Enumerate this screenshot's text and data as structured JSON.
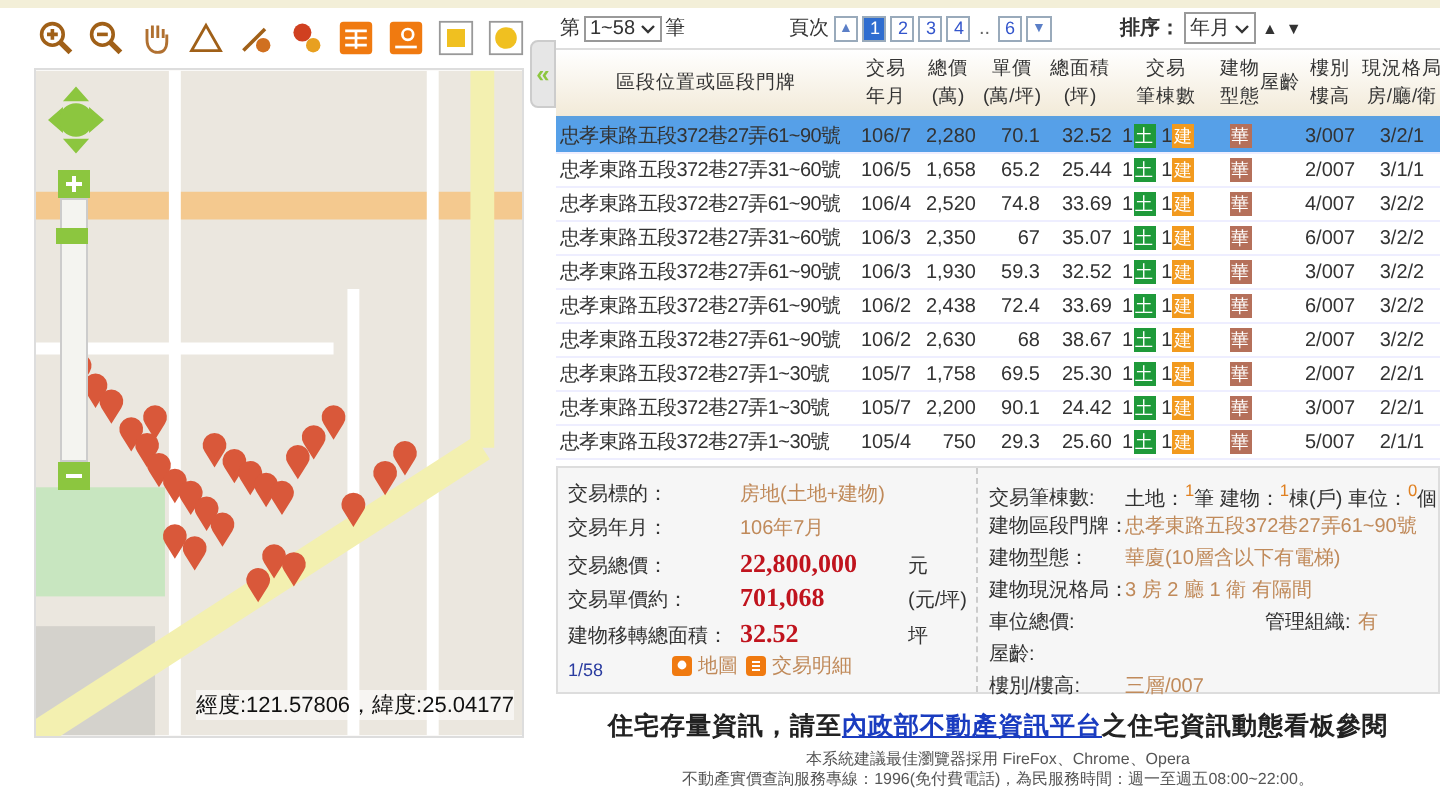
{
  "map": {
    "zoom_slider": {
      "level": 0.88
    },
    "coordinates": "經度:121.57806，緯度:25.04177"
  },
  "collapse_toggle": "«",
  "paging": {
    "prefix": "第",
    "range": "1~58",
    "suffix": "筆",
    "page_label": "頁次",
    "prev": "▲",
    "next": "▼",
    "pages": [
      {
        "label": "1",
        "kind": "page",
        "selected": true
      },
      {
        "label": "2",
        "kind": "page",
        "selected": false
      },
      {
        "label": "3",
        "kind": "page",
        "selected": false
      },
      {
        "label": "4",
        "kind": "page",
        "selected": false
      },
      {
        "label": "..",
        "kind": "gap"
      },
      {
        "label": "6",
        "kind": "page",
        "selected": false
      }
    ],
    "sort_label": "排序：",
    "sort_value": "年月",
    "sort_asc": "▲",
    "sort_desc": "▼"
  },
  "table": {
    "columns": [
      {
        "lines": [
          "區段位置或區段門牌"
        ]
      },
      {
        "lines": [
          "交易",
          "年月"
        ]
      },
      {
        "lines": [
          "總價",
          "(萬)"
        ]
      },
      {
        "lines": [
          "單價",
          "(萬/坪)"
        ]
      },
      {
        "lines": [
          "總面積",
          "(坪)"
        ]
      },
      {
        "lines": [
          "交易",
          "筆棟數"
        ]
      },
      {
        "lines": [
          "建物",
          "型態"
        ]
      },
      {
        "lines": [
          "屋齡"
        ]
      },
      {
        "lines": [
          "樓別",
          "樓高"
        ]
      },
      {
        "lines": [
          "現況格局",
          "房/廳/衛"
        ]
      }
    ],
    "rows": [
      {
        "selected": true,
        "address": "忠孝東路五段372巷27弄61~90號",
        "date": "106/7",
        "total": "2,280",
        "unit": "70.1",
        "area": "32.52",
        "land": "1",
        "land_badge": "土",
        "building": "1",
        "building_badge": "建",
        "type_badge": "華",
        "floor": "3/007",
        "layout": "3/2/1"
      },
      {
        "selected": false,
        "address": "忠孝東路五段372巷27弄31~60號",
        "date": "106/5",
        "total": "1,658",
        "unit": "65.2",
        "area": "25.44",
        "land": "1",
        "land_badge": "土",
        "building": "1",
        "building_badge": "建",
        "type_badge": "華",
        "floor": "2/007",
        "layout": "3/1/1"
      },
      {
        "selected": false,
        "address": "忠孝東路五段372巷27弄61~90號",
        "date": "106/4",
        "total": "2,520",
        "unit": "74.8",
        "area": "33.69",
        "land": "1",
        "land_badge": "土",
        "building": "1",
        "building_badge": "建",
        "type_badge": "華",
        "floor": "4/007",
        "layout": "3/2/2"
      },
      {
        "selected": false,
        "address": "忠孝東路五段372巷27弄31~60號",
        "date": "106/3",
        "total": "2,350",
        "unit": "67",
        "area": "35.07",
        "land": "1",
        "land_badge": "土",
        "building": "1",
        "building_badge": "建",
        "type_badge": "華",
        "floor": "6/007",
        "layout": "3/2/2"
      },
      {
        "selected": false,
        "address": "忠孝東路五段372巷27弄61~90號",
        "date": "106/3",
        "total": "1,930",
        "unit": "59.3",
        "area": "32.52",
        "land": "1",
        "land_badge": "土",
        "building": "1",
        "building_badge": "建",
        "type_badge": "華",
        "floor": "3/007",
        "layout": "3/2/2"
      },
      {
        "selected": false,
        "address": "忠孝東路五段372巷27弄61~90號",
        "date": "106/2",
        "total": "2,438",
        "unit": "72.4",
        "area": "33.69",
        "land": "1",
        "land_badge": "土",
        "building": "1",
        "building_badge": "建",
        "type_badge": "華",
        "floor": "6/007",
        "layout": "3/2/2"
      },
      {
        "selected": false,
        "address": "忠孝東路五段372巷27弄61~90號",
        "date": "106/2",
        "total": "2,630",
        "unit": "68",
        "area": "38.67",
        "land": "1",
        "land_badge": "土",
        "building": "1",
        "building_badge": "建",
        "type_badge": "華",
        "floor": "2/007",
        "layout": "3/2/2"
      },
      {
        "selected": false,
        "address": "忠孝東路五段372巷27弄1~30號",
        "date": "105/7",
        "total": "1,758",
        "unit": "69.5",
        "area": "25.30",
        "land": "1",
        "land_badge": "土",
        "building": "1",
        "building_badge": "建",
        "type_badge": "華",
        "floor": "2/007",
        "layout": "2/2/1"
      },
      {
        "selected": false,
        "address": "忠孝東路五段372巷27弄1~30號",
        "date": "105/7",
        "total": "2,200",
        "unit": "90.1",
        "area": "24.42",
        "land": "1",
        "land_badge": "土",
        "building": "1",
        "building_badge": "建",
        "type_badge": "華",
        "floor": "3/007",
        "layout": "2/2/1"
      },
      {
        "selected": false,
        "address": "忠孝東路五段372巷27弄1~30號",
        "date": "105/4",
        "total": "750",
        "unit": "29.3",
        "area": "25.60",
        "land": "1",
        "land_badge": "土",
        "building": "1",
        "building_badge": "建",
        "type_badge": "華",
        "floor": "5/007",
        "layout": "2/1/1"
      }
    ]
  },
  "detail": {
    "left": [
      {
        "kind": "plain",
        "label": "交易標的：",
        "value": "房地(土地+建物)"
      },
      {
        "kind": "plain",
        "label": "交易年月：",
        "value": "106年7月"
      },
      {
        "kind": "price",
        "label": "交易總價：",
        "value": "22,800,000",
        "unit": "元"
      },
      {
        "kind": "price",
        "label": "交易單價約：",
        "value": "701,068",
        "unit": "(元/坪)"
      },
      {
        "kind": "price",
        "label": "建物移轉總面積：",
        "value": "32.52",
        "unit": "坪"
      }
    ],
    "record": "1/58",
    "map_button": "地圖",
    "detail_button": "交易明細",
    "right": [
      {
        "kind": "counts",
        "label": "交易筆棟數:",
        "value": "土地：$^{1}$筆 建物：$^{1}$棟(戶) 車位：$^{0}$個"
      },
      {
        "kind": "plain",
        "label": "建物區段門牌：",
        "value": "忠孝東路五段372巷27弄61~90號"
      },
      {
        "kind": "plain",
        "label": "建物型態：",
        "value": "華廈(10層含以下有電梯)"
      },
      {
        "kind": "plain",
        "label": "建物現況格局：",
        "value": "3 房 2 廳 1 衛 有隔間"
      },
      {
        "kind": "pair",
        "label": "車位總價:",
        "label2": "管理組織:",
        "value2": "有"
      },
      {
        "kind": "plain",
        "label": "屋齡:"
      },
      {
        "kind": "plain",
        "label": "樓別/樓高:",
        "value": "三層/007"
      }
    ]
  },
  "notice": {
    "before": "住宅存量資訊，請至",
    "link": "內政部不動產資訊平台",
    "after": "之住宅資訊動態看板參閱"
  },
  "footer": [
    "本系統建議最佳瀏覽器採用 FireFox、Chrome、Opera",
    "不動產實價查詢服務專線：1996(免付費電話)，為民服務時間：週一至週五08:00~22:00。"
  ]
}
